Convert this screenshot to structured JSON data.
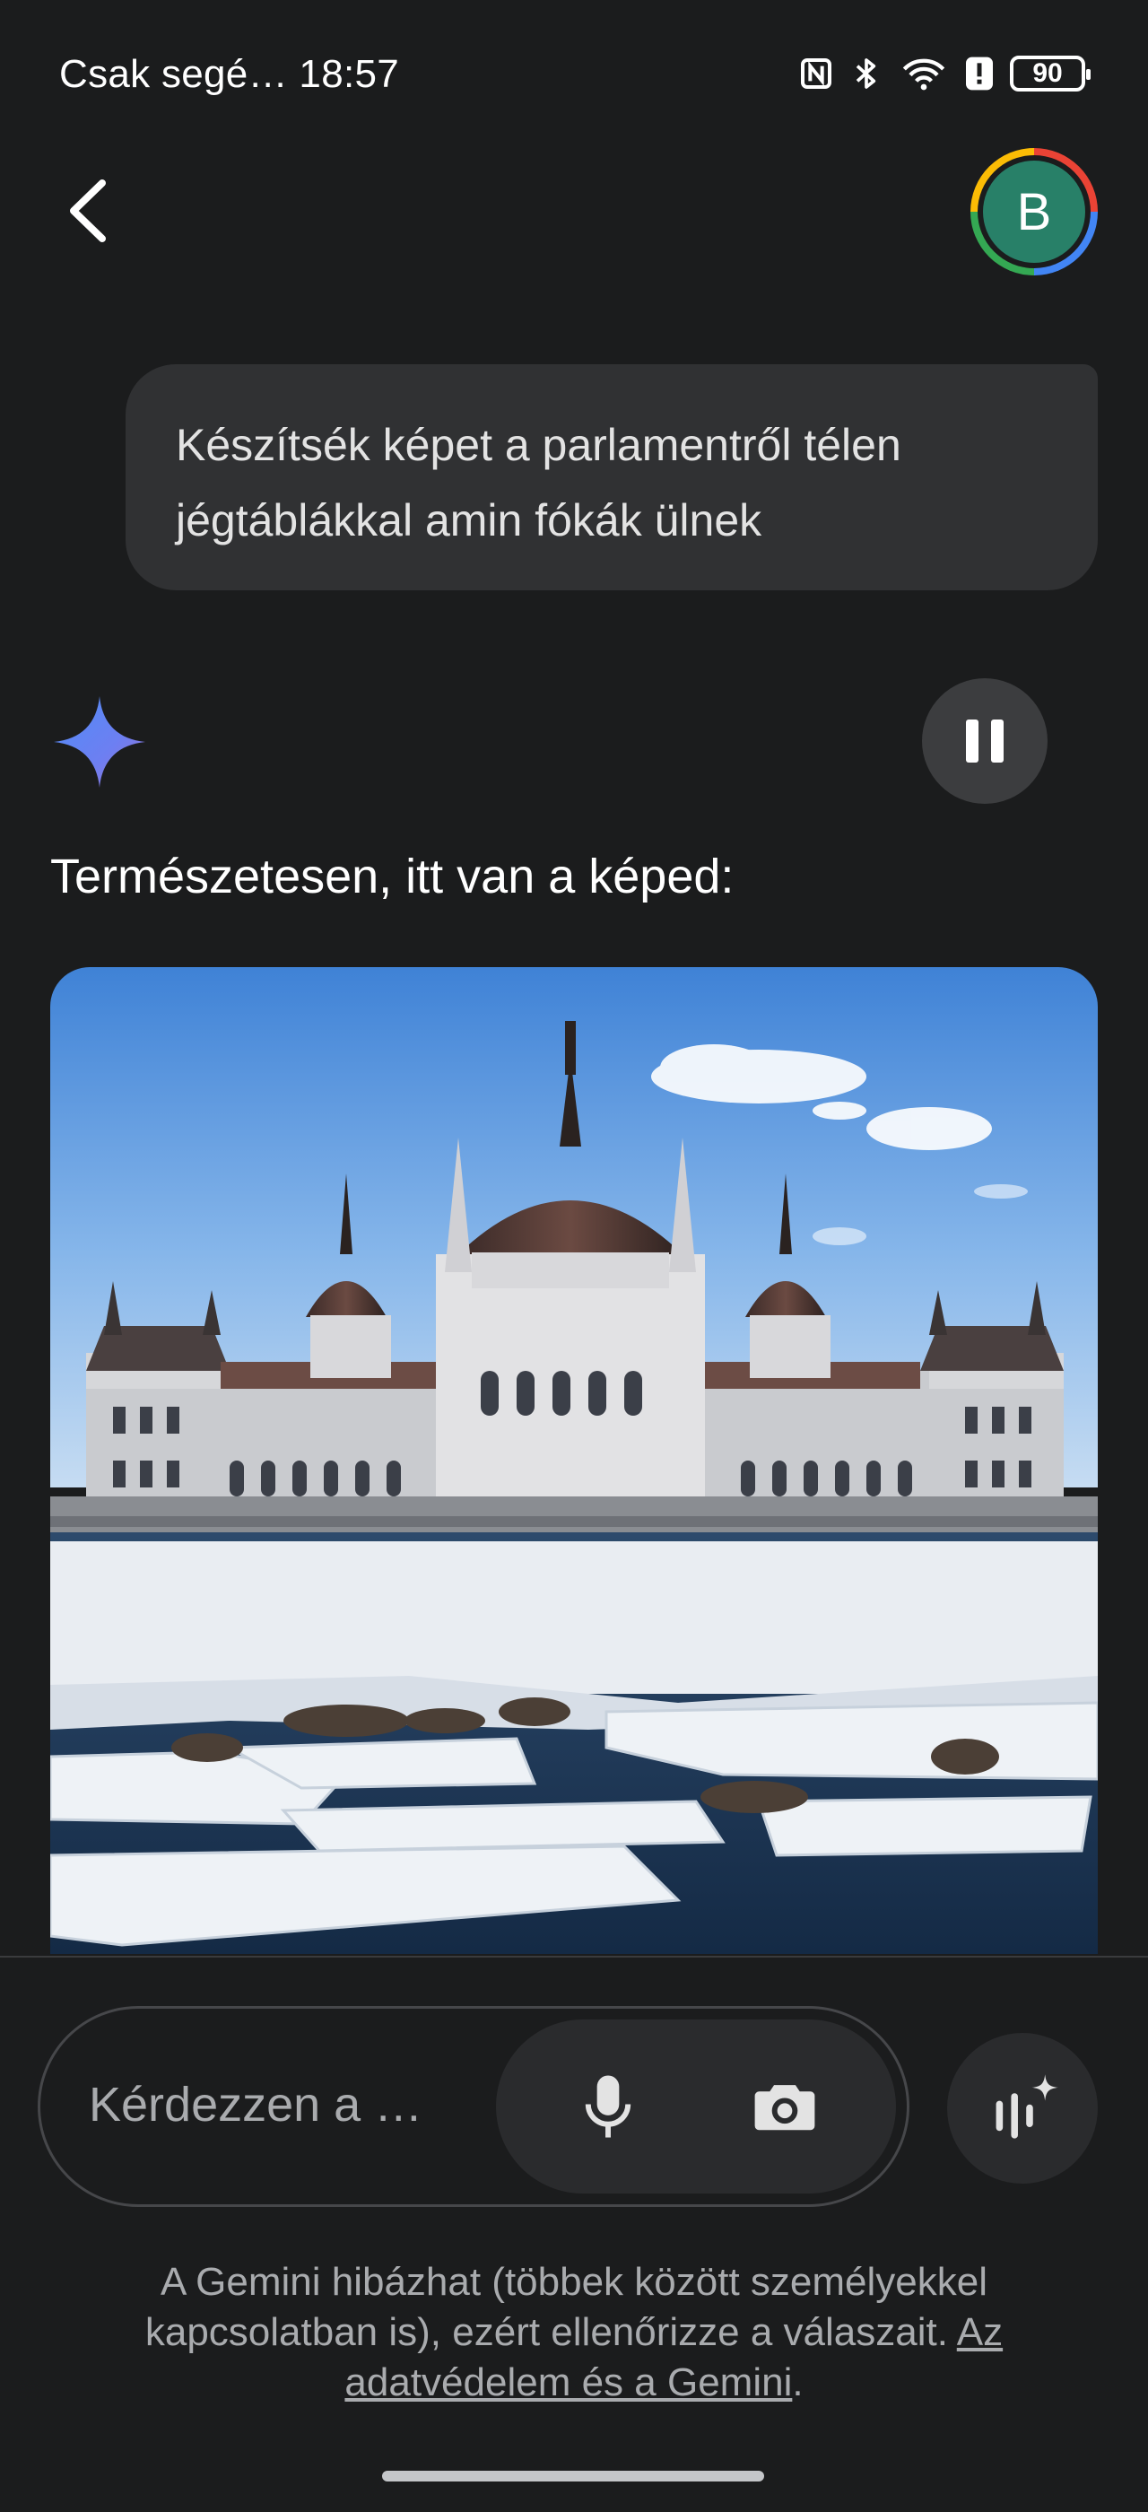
{
  "status_bar": {
    "carrier": "Csak segé…",
    "time": "18:57",
    "battery": "90",
    "icons": [
      "nfc-icon",
      "bluetooth-icon",
      "wifi-icon",
      "alert-icon",
      "battery-icon"
    ]
  },
  "header": {
    "back_icon": "back-arrow-icon",
    "avatar_initial": "B"
  },
  "conversation": {
    "user_message": "Készítsék képet a parlamentről télen jégtáblákkal amin fókák ülnek",
    "assistant_intro": "Természetesen, itt van a képed:",
    "assistant_icon": "gemini-sparkle-icon",
    "pause_icon": "pause-icon"
  },
  "input": {
    "placeholder": "Kérdezzen a …",
    "mic_icon": "microphone-icon",
    "camera_icon": "camera-icon",
    "live_icon": "gemini-live-icon"
  },
  "disclaimer": {
    "text": "A Gemini hibázhat (többek között személyekkel kapcsolatban is), ezért ellenőrizze a válaszait.",
    "link": "Az adatvédelem és a Gemini",
    "end": "."
  },
  "colors": {
    "background": "#1b1c1d",
    "bubble": "#303133",
    "avatar": "#288068",
    "gemini_blue": "#4f8df7"
  }
}
